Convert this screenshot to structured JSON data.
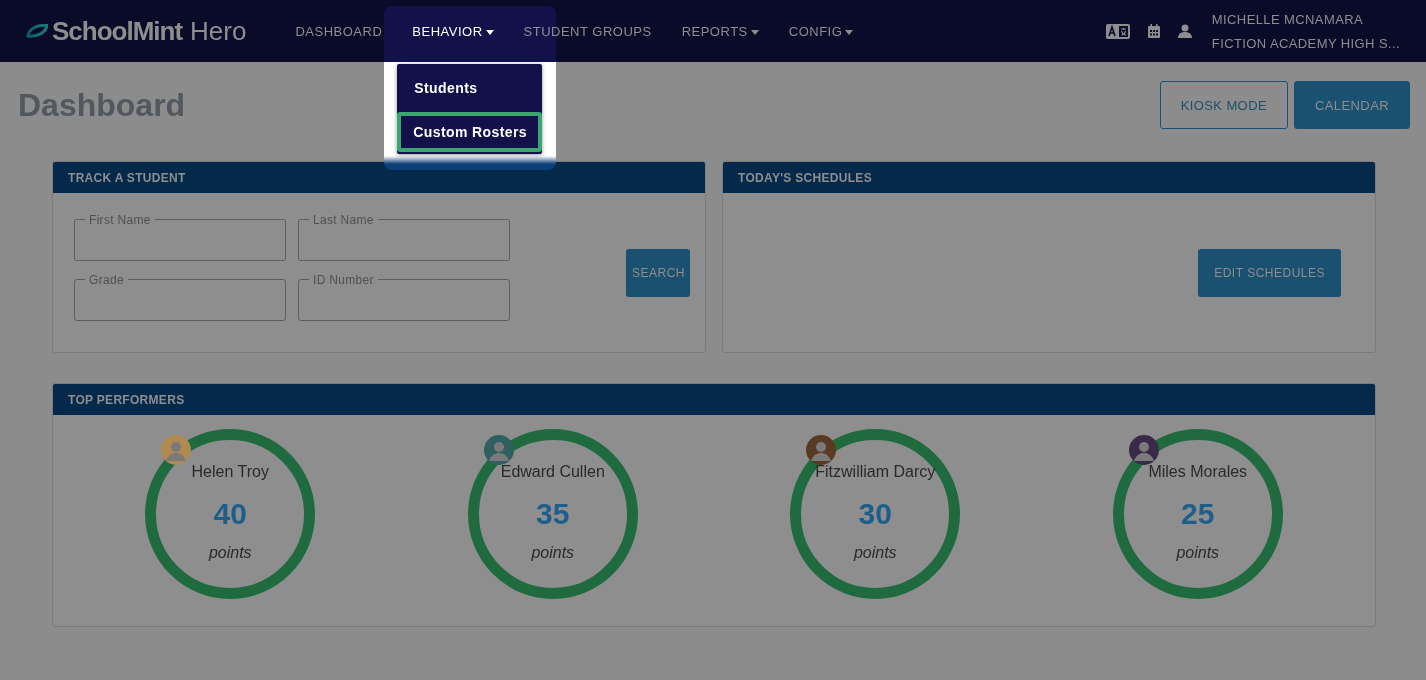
{
  "brand": {
    "name": "SchoolMint",
    "suffix": "Hero"
  },
  "nav": [
    {
      "label": "DASHBOARD",
      "has_menu": false,
      "expanded": false
    },
    {
      "label": "BEHAVIOR",
      "has_menu": true,
      "expanded": true
    },
    {
      "label": "STUDENT GROUPS",
      "has_menu": false,
      "expanded": false
    },
    {
      "label": "REPORTS",
      "has_menu": true,
      "expanded": false
    },
    {
      "label": "CONFIG",
      "has_menu": true,
      "expanded": false
    }
  ],
  "dropdown": [
    {
      "label": "Students",
      "selected": false
    },
    {
      "label": "Custom Rosters",
      "selected": true
    }
  ],
  "user": {
    "name": "MICHELLE MCNAMARA",
    "school": "FICTION ACADEMY HIGH S..."
  },
  "page_title": "Dashboard",
  "header_buttons": [
    {
      "label": "KIOSK MODE",
      "kind": "outline"
    },
    {
      "label": "CALENDAR",
      "kind": "solid"
    }
  ],
  "track_panel": {
    "title": "TRACK A STUDENT",
    "fields": [
      {
        "label": "First Name"
      },
      {
        "label": "Last Name"
      },
      {
        "label": "Grade"
      },
      {
        "label": "ID Number"
      }
    ],
    "button": "SEARCH"
  },
  "schedules_panel": {
    "title": "TODAY'S SCHEDULES",
    "button": "EDIT SCHEDULES"
  },
  "performers_panel": {
    "title": "TOP PERFORMERS",
    "performers": [
      {
        "name": "Helen Troy",
        "points": "40",
        "unit": "points",
        "color": "#b08a50"
      },
      {
        "name": "Edward Cullen",
        "points": "35",
        "unit": "points",
        "color": "#2f5f60"
      },
      {
        "name": "Fitzwilliam Darcy",
        "points": "30",
        "unit": "points",
        "color": "#5a3a20"
      },
      {
        "name": "Miles Morales",
        "points": "25",
        "unit": "points",
        "color": "#3a2a4a"
      }
    ]
  }
}
